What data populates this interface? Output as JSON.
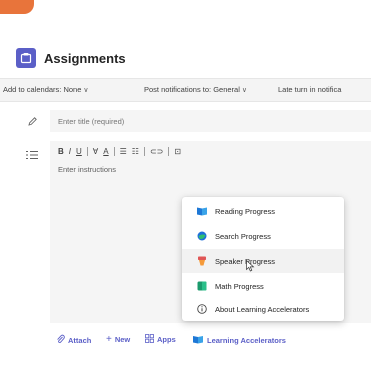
{
  "header": {
    "title": "Assignments",
    "accent_color": "#5b5fc7",
    "app_icon": "assignments-icon"
  },
  "settings": {
    "add_to_calendars": "Add to calendars: None",
    "post_notifications": "Post notifications to: General",
    "late_turn_in": "Late turn in notifica"
  },
  "form": {
    "title_placeholder": "Enter title (required)",
    "instructions_placeholder": "Enter instructions"
  },
  "toolbar": {
    "bold": "B",
    "italic": "I",
    "underline": "U",
    "highlight": "∀",
    "font_color": "A",
    "bullets": "☰",
    "numbers": "☷",
    "link": "⊂⊃",
    "image": "⊡"
  },
  "menu": {
    "items": [
      {
        "label": "Reading Progress",
        "icon": "reading-progress-icon"
      },
      {
        "label": "Search Progress",
        "icon": "search-progress-icon"
      },
      {
        "label": "Speaker Progress",
        "icon": "speaker-progress-icon"
      },
      {
        "label": "Math Progress",
        "icon": "math-progress-icon"
      },
      {
        "label": "About Learning Accelerators",
        "icon": "info-icon"
      }
    ]
  },
  "bottom": {
    "attach": "Attach",
    "new": "New",
    "apps": "Apps",
    "learning_accelerators": "Learning Accelerators"
  }
}
